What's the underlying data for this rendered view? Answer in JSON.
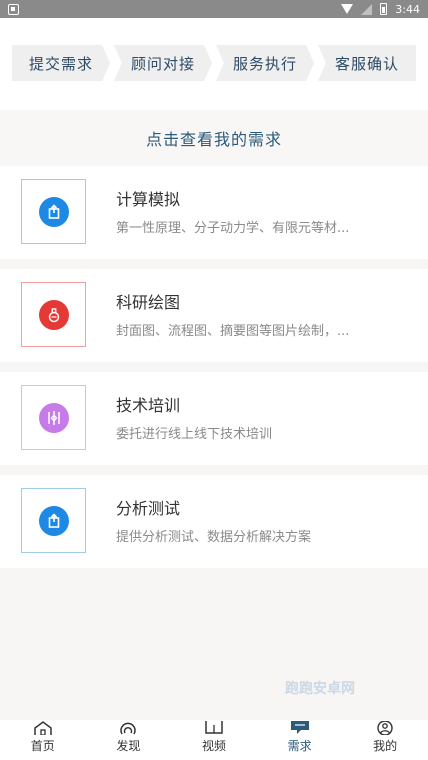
{
  "status_bar": {
    "time": "3:44"
  },
  "steps": [
    {
      "label": "提交需求"
    },
    {
      "label": "顾问对接"
    },
    {
      "label": "服务执行"
    },
    {
      "label": "客服确认"
    }
  ],
  "view_link": "点击查看我的需求",
  "services": [
    {
      "title": "计算模拟",
      "desc": "第一性原理、分子动力学、有限元等材...",
      "icon": "export-icon",
      "color": "#1e88e5",
      "border": "#9ecde8"
    },
    {
      "title": "科研绘图",
      "desc": "封面图、流程图、摘要图等图片绘制，...",
      "icon": "flask-icon",
      "color": "#e53935",
      "border": "#f0a0a0"
    },
    {
      "title": "技术培训",
      "desc": "委托进行线上线下技术培训",
      "icon": "compass-icon",
      "color": "#c77be8",
      "border": "#e3b6f2"
    },
    {
      "title": "分析测试",
      "desc": "提供分析测试、数据分析解决方案",
      "icon": "export-icon",
      "color": "#1e88e5",
      "border": "#9ecde8"
    }
  ],
  "tabs": [
    {
      "label": "首页",
      "icon": "home-icon"
    },
    {
      "label": "发现",
      "icon": "discover-icon"
    },
    {
      "label": "视频",
      "icon": "video-icon"
    },
    {
      "label": "需求",
      "icon": "demand-icon",
      "active": true
    },
    {
      "label": "我的",
      "icon": "profile-icon"
    }
  ],
  "watermark": "跑跑安卓网"
}
